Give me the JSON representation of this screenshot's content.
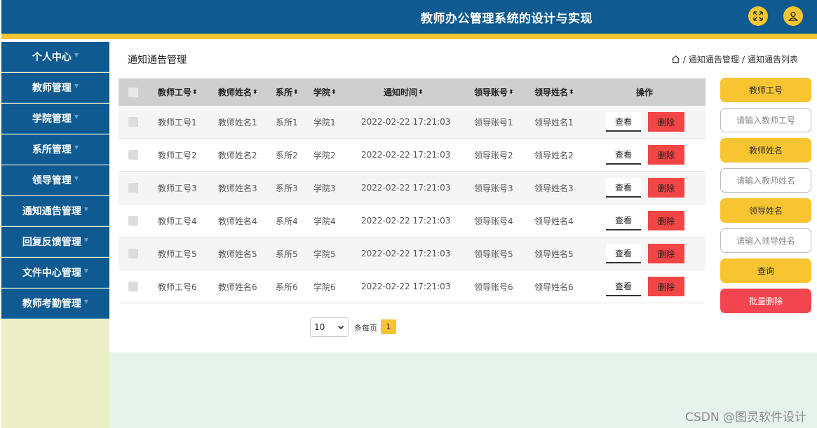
{
  "header": {
    "title": "教师办公管理系统的设计与实现",
    "fullscreen_icon": "expand-arrows-icon",
    "user_icon": "user-icon"
  },
  "sidebar": {
    "items": [
      {
        "label": "个人中心"
      },
      {
        "label": "教师管理"
      },
      {
        "label": "学院管理"
      },
      {
        "label": "系所管理"
      },
      {
        "label": "领导管理"
      },
      {
        "label": "通知通告管理"
      },
      {
        "label": "回复反馈管理"
      },
      {
        "label": "文件中心管理"
      },
      {
        "label": "教师考勤管理"
      }
    ]
  },
  "page": {
    "title": "通知通告管理",
    "breadcrumb": {
      "separator": "/",
      "level1": "通知通告管理",
      "level2": "通知通告列表"
    }
  },
  "table": {
    "columns": [
      "教师工号",
      "教师姓名",
      "系所",
      "学院",
      "通知时间",
      "领导账号",
      "领导姓名",
      "操作"
    ],
    "sort_icon": "⬍",
    "view_label": "查看",
    "delete_label": "删除",
    "rows": [
      {
        "teacher_id": "教师工号1",
        "teacher_name": "教师姓名1",
        "dept": "系所1",
        "college": "学院1",
        "time": "2022-02-22 17:21:03",
        "leader_account": "领导账号1",
        "leader_name": "领导姓名1"
      },
      {
        "teacher_id": "教师工号2",
        "teacher_name": "教师姓名2",
        "dept": "系所2",
        "college": "学院2",
        "time": "2022-02-22 17:21:03",
        "leader_account": "领导账号2",
        "leader_name": "领导姓名2"
      },
      {
        "teacher_id": "教师工号3",
        "teacher_name": "教师姓名3",
        "dept": "系所3",
        "college": "学院3",
        "time": "2022-02-22 17:21:03",
        "leader_account": "领导账号3",
        "leader_name": "领导姓名3"
      },
      {
        "teacher_id": "教师工号4",
        "teacher_name": "教师姓名4",
        "dept": "系所4",
        "college": "学院4",
        "time": "2022-02-22 17:21:03",
        "leader_account": "领导账号4",
        "leader_name": "领导姓名4"
      },
      {
        "teacher_id": "教师工号5",
        "teacher_name": "教师姓名5",
        "dept": "系所5",
        "college": "学院5",
        "time": "2022-02-22 17:21:03",
        "leader_account": "领导账号5",
        "leader_name": "领导姓名5"
      },
      {
        "teacher_id": "教师工号6",
        "teacher_name": "教师姓名6",
        "dept": "系所6",
        "college": "学院6",
        "time": "2022-02-22 17:21:03",
        "leader_account": "领导账号6",
        "leader_name": "领导姓名6"
      }
    ]
  },
  "pagination": {
    "page_size": "10",
    "per_page_label": "条每页",
    "current_page": "1"
  },
  "search": {
    "teacher_id_label": "教师工号",
    "teacher_id_placeholder": "请输入教师工号",
    "teacher_name_label": "教师姓名",
    "teacher_name_placeholder": "请输入教师姓名",
    "leader_name_label": "领导姓名",
    "leader_name_placeholder": "请输入领导姓名",
    "query_label": "查询",
    "batch_delete_label": "批量删除"
  },
  "watermark": "CSDN @图灵软件设计",
  "colors": {
    "primary": "#0f5a91",
    "accent": "#f7c532",
    "danger": "#f24545",
    "sidebar_bg": "#eaefc7",
    "footer_bg": "#e6f2ec"
  }
}
